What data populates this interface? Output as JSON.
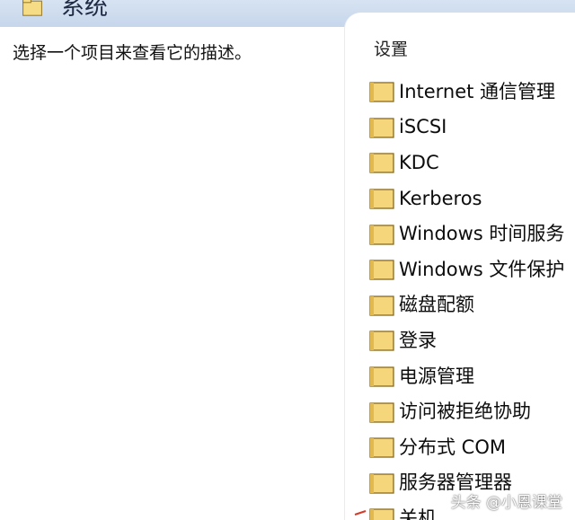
{
  "header": {
    "title": "系统",
    "icon": "folder-icon"
  },
  "description": {
    "text": "选择一个项目来查看它的描述。"
  },
  "settings": {
    "column_header": "设置",
    "items": [
      {
        "label": "Internet 通信管理",
        "icon": "folder-icon"
      },
      {
        "label": "iSCSI",
        "icon": "folder-icon"
      },
      {
        "label": "KDC",
        "icon": "folder-icon"
      },
      {
        "label": "Kerberos",
        "icon": "folder-icon"
      },
      {
        "label": "Windows 时间服务",
        "icon": "folder-icon"
      },
      {
        "label": "Windows 文件保护",
        "icon": "folder-icon"
      },
      {
        "label": "磁盘配额",
        "icon": "folder-icon"
      },
      {
        "label": "登录",
        "icon": "folder-icon"
      },
      {
        "label": "电源管理",
        "icon": "folder-icon"
      },
      {
        "label": "访问被拒绝协助",
        "icon": "folder-icon"
      },
      {
        "label": "分布式 COM",
        "icon": "folder-icon"
      },
      {
        "label": "服务器管理器",
        "icon": "folder-icon"
      },
      {
        "label": "关机",
        "icon": "folder-icon"
      }
    ]
  },
  "watermark": {
    "text": "头条 @小恩课堂"
  },
  "colors": {
    "header_bg": "#c6d6eb",
    "folder_fill": "#f5d67a",
    "folder_stroke": "#8a6a1e"
  }
}
